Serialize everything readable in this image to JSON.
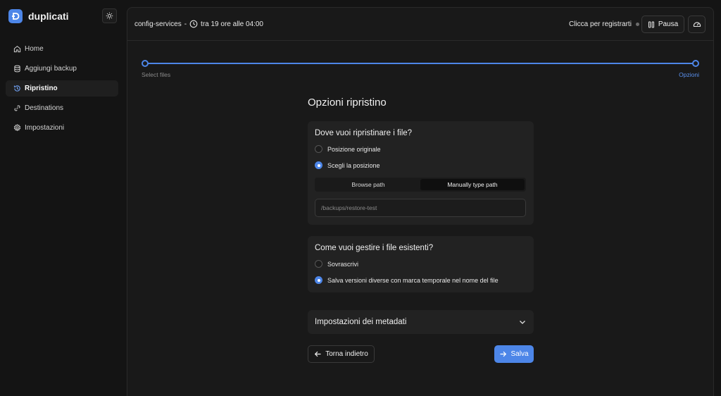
{
  "app": {
    "name": "duplicati"
  },
  "sidebar": {
    "items": [
      {
        "label": "Home",
        "icon": "home-icon",
        "active": false
      },
      {
        "label": "Aggiungi backup",
        "icon": "database-icon",
        "active": false
      },
      {
        "label": "Ripristino",
        "icon": "history-icon",
        "active": true
      },
      {
        "label": "Destinations",
        "icon": "link-icon",
        "active": false
      },
      {
        "label": "Impostazioni",
        "icon": "gear-icon",
        "active": false
      }
    ]
  },
  "header": {
    "backup_name": "config-services",
    "separator": "-",
    "schedule": "tra 19 ore alle 04:00",
    "register": "Clicca per registrarti",
    "pause_label": "Pausa"
  },
  "stepper": {
    "steps": [
      "Select files",
      "Opzioni"
    ],
    "progress": 1.0
  },
  "main": {
    "title": "Opzioni ripristino",
    "destination": {
      "title": "Dove vuoi ripristinare i file?",
      "options": [
        "Posizione originale",
        "Scegli la posizione"
      ],
      "selected": 1,
      "path_modes": [
        "Browse path",
        "Manually type path"
      ],
      "active_mode": 1,
      "path_placeholder": "/backups/restore-test"
    },
    "existing": {
      "title": "Come vuoi gestire i file esistenti?",
      "options": [
        "Sovrascrivi",
        "Salva versioni diverse con marca temporale nel nome del file"
      ],
      "selected": 1
    },
    "metadata": {
      "title": "Impostazioni dei metadati"
    },
    "back_label": "Torna indietro",
    "save_label": "Salva"
  },
  "colors": {
    "accent": "#4d86e8",
    "background": "#141414",
    "panel": "#191919",
    "card": "#222222"
  }
}
